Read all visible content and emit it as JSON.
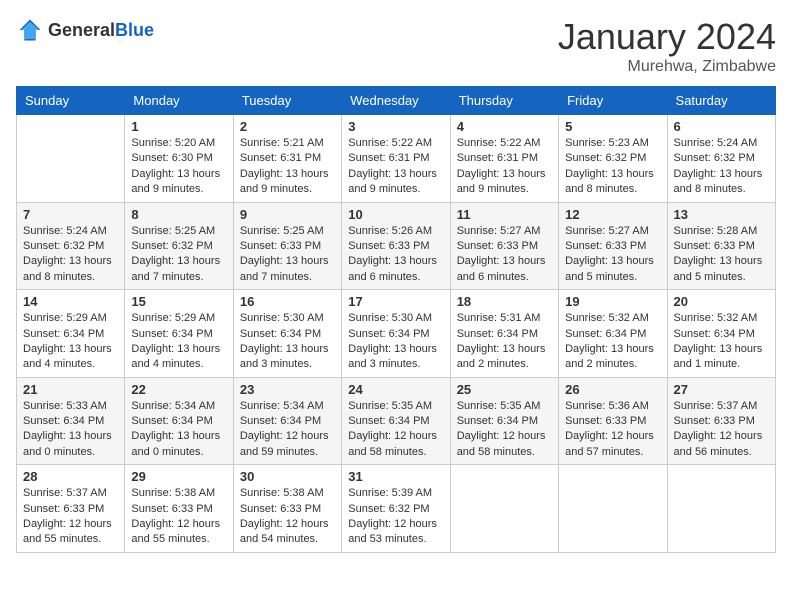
{
  "header": {
    "logo": {
      "general": "General",
      "blue": "Blue"
    },
    "month_year": "January 2024",
    "location": "Murehwa, Zimbabwe"
  },
  "calendar": {
    "weekdays": [
      "Sunday",
      "Monday",
      "Tuesday",
      "Wednesday",
      "Thursday",
      "Friday",
      "Saturday"
    ],
    "weeks": [
      [
        {
          "day": "",
          "info": ""
        },
        {
          "day": "1",
          "info": "Sunrise: 5:20 AM\nSunset: 6:30 PM\nDaylight: 13 hours\nand 9 minutes."
        },
        {
          "day": "2",
          "info": "Sunrise: 5:21 AM\nSunset: 6:31 PM\nDaylight: 13 hours\nand 9 minutes."
        },
        {
          "day": "3",
          "info": "Sunrise: 5:22 AM\nSunset: 6:31 PM\nDaylight: 13 hours\nand 9 minutes."
        },
        {
          "day": "4",
          "info": "Sunrise: 5:22 AM\nSunset: 6:31 PM\nDaylight: 13 hours\nand 9 minutes."
        },
        {
          "day": "5",
          "info": "Sunrise: 5:23 AM\nSunset: 6:32 PM\nDaylight: 13 hours\nand 8 minutes."
        },
        {
          "day": "6",
          "info": "Sunrise: 5:24 AM\nSunset: 6:32 PM\nDaylight: 13 hours\nand 8 minutes."
        }
      ],
      [
        {
          "day": "7",
          "info": "Sunrise: 5:24 AM\nSunset: 6:32 PM\nDaylight: 13 hours\nand 8 minutes."
        },
        {
          "day": "8",
          "info": "Sunrise: 5:25 AM\nSunset: 6:32 PM\nDaylight: 13 hours\nand 7 minutes."
        },
        {
          "day": "9",
          "info": "Sunrise: 5:25 AM\nSunset: 6:33 PM\nDaylight: 13 hours\nand 7 minutes."
        },
        {
          "day": "10",
          "info": "Sunrise: 5:26 AM\nSunset: 6:33 PM\nDaylight: 13 hours\nand 6 minutes."
        },
        {
          "day": "11",
          "info": "Sunrise: 5:27 AM\nSunset: 6:33 PM\nDaylight: 13 hours\nand 6 minutes."
        },
        {
          "day": "12",
          "info": "Sunrise: 5:27 AM\nSunset: 6:33 PM\nDaylight: 13 hours\nand 5 minutes."
        },
        {
          "day": "13",
          "info": "Sunrise: 5:28 AM\nSunset: 6:33 PM\nDaylight: 13 hours\nand 5 minutes."
        }
      ],
      [
        {
          "day": "14",
          "info": "Sunrise: 5:29 AM\nSunset: 6:34 PM\nDaylight: 13 hours\nand 4 minutes."
        },
        {
          "day": "15",
          "info": "Sunrise: 5:29 AM\nSunset: 6:34 PM\nDaylight: 13 hours\nand 4 minutes."
        },
        {
          "day": "16",
          "info": "Sunrise: 5:30 AM\nSunset: 6:34 PM\nDaylight: 13 hours\nand 3 minutes."
        },
        {
          "day": "17",
          "info": "Sunrise: 5:30 AM\nSunset: 6:34 PM\nDaylight: 13 hours\nand 3 minutes."
        },
        {
          "day": "18",
          "info": "Sunrise: 5:31 AM\nSunset: 6:34 PM\nDaylight: 13 hours\nand 2 minutes."
        },
        {
          "day": "19",
          "info": "Sunrise: 5:32 AM\nSunset: 6:34 PM\nDaylight: 13 hours\nand 2 minutes."
        },
        {
          "day": "20",
          "info": "Sunrise: 5:32 AM\nSunset: 6:34 PM\nDaylight: 13 hours\nand 1 minute."
        }
      ],
      [
        {
          "day": "21",
          "info": "Sunrise: 5:33 AM\nSunset: 6:34 PM\nDaylight: 13 hours\nand 0 minutes."
        },
        {
          "day": "22",
          "info": "Sunrise: 5:34 AM\nSunset: 6:34 PM\nDaylight: 13 hours\nand 0 minutes."
        },
        {
          "day": "23",
          "info": "Sunrise: 5:34 AM\nSunset: 6:34 PM\nDaylight: 12 hours\nand 59 minutes."
        },
        {
          "day": "24",
          "info": "Sunrise: 5:35 AM\nSunset: 6:34 PM\nDaylight: 12 hours\nand 58 minutes."
        },
        {
          "day": "25",
          "info": "Sunrise: 5:35 AM\nSunset: 6:34 PM\nDaylight: 12 hours\nand 58 minutes."
        },
        {
          "day": "26",
          "info": "Sunrise: 5:36 AM\nSunset: 6:33 PM\nDaylight: 12 hours\nand 57 minutes."
        },
        {
          "day": "27",
          "info": "Sunrise: 5:37 AM\nSunset: 6:33 PM\nDaylight: 12 hours\nand 56 minutes."
        }
      ],
      [
        {
          "day": "28",
          "info": "Sunrise: 5:37 AM\nSunset: 6:33 PM\nDaylight: 12 hours\nand 55 minutes."
        },
        {
          "day": "29",
          "info": "Sunrise: 5:38 AM\nSunset: 6:33 PM\nDaylight: 12 hours\nand 55 minutes."
        },
        {
          "day": "30",
          "info": "Sunrise: 5:38 AM\nSunset: 6:33 PM\nDaylight: 12 hours\nand 54 minutes."
        },
        {
          "day": "31",
          "info": "Sunrise: 5:39 AM\nSunset: 6:32 PM\nDaylight: 12 hours\nand 53 minutes."
        },
        {
          "day": "",
          "info": ""
        },
        {
          "day": "",
          "info": ""
        },
        {
          "day": "",
          "info": ""
        }
      ]
    ]
  }
}
